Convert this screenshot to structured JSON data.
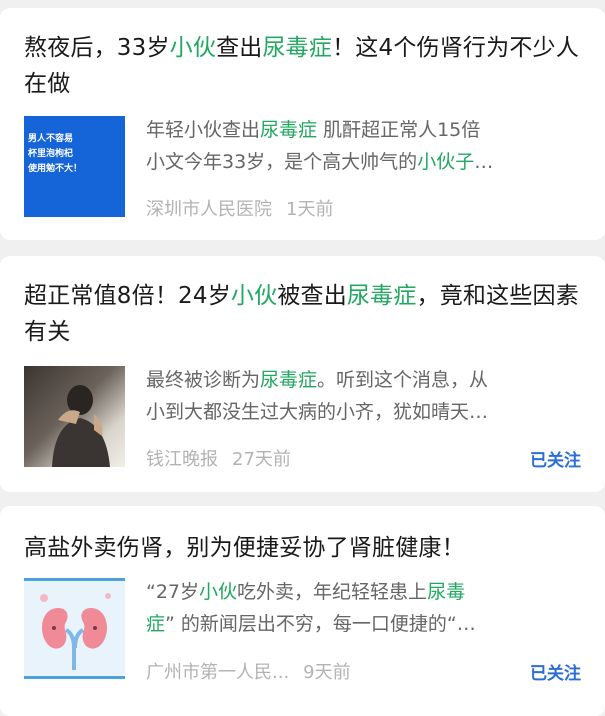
{
  "articles": [
    {
      "title_parts": [
        "熬夜后，33岁",
        "小伙",
        "查出",
        "尿毒症",
        "！这4个伤肾行为不少人在做"
      ],
      "summary_line1_parts": [
        "年轻小伙查出",
        "尿毒症",
        " 肌酐超正常人15倍"
      ],
      "summary_line2_parts": [
        "小文今年33岁，是个高大帅气的",
        "小伙子",
        "…"
      ],
      "thumb_lines": [
        "男人不容易",
        "杯里泡枸杞",
        "使用勉不大！"
      ],
      "source": "深圳市人民医院",
      "time": "1天前",
      "follow": ""
    },
    {
      "title_parts": [
        "超正常值8倍！24岁",
        "小伙",
        "被查出",
        "尿毒症",
        "，竟和这些因素有关"
      ],
      "summary_line1_parts": [
        "最终被诊断为",
        "尿毒症",
        "。听到这个消息，从"
      ],
      "summary_line2_parts": [
        "小到大都没生过大病的小齐，犹如晴天…"
      ],
      "source": "钱江晚报",
      "time": "27天前",
      "follow": "已关注"
    },
    {
      "title_parts": [
        "高盐外卖伤肾，别为便捷妥协了肾脏健康！"
      ],
      "summary_line1_parts": [
        "“27岁",
        "小伙",
        "吃外卖，年纪轻轻患上",
        "尿毒"
      ],
      "summary_line2_parts": [
        "症",
        "” 的新闻层出不穷，每一口便捷的“…"
      ],
      "source": "广州市第一人民...",
      "time": "9天前",
      "follow": "已关注"
    }
  ],
  "colors": {
    "highlight": "#22a861",
    "follow": "#2b6fd6",
    "meta": "#b3b3b3"
  }
}
